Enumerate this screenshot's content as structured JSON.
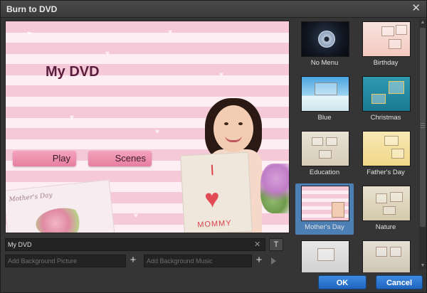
{
  "window": {
    "title": "Burn to DVD"
  },
  "preview": {
    "dvd_title": "My DVD",
    "play_label": "Play",
    "scenes_label": "Scenes",
    "card_text": "Mother's Day",
    "sign_top": "I",
    "sign_bottom": "MOMMY"
  },
  "inputs": {
    "title_value": "My DVD",
    "bg_picture_placeholder": "Add Background Picture",
    "bg_music_placeholder": "Add Background Music",
    "font_button": "T"
  },
  "templates": [
    {
      "label": "No Menu"
    },
    {
      "label": "Birthday"
    },
    {
      "label": "Blue"
    },
    {
      "label": "Christmas"
    },
    {
      "label": "Education"
    },
    {
      "label": "Father's Day"
    },
    {
      "label": "Mother's Day"
    },
    {
      "label": "Nature"
    }
  ],
  "selected_template": "Mother's Day",
  "footer": {
    "ok_label": "OK",
    "cancel_label": "Cancel"
  },
  "icons": {
    "close": "close-icon",
    "clear": "clear-icon",
    "add": "plus-icon",
    "play": "play-icon",
    "font": "text-format-icon"
  },
  "colors": {
    "accent": "#2f7ad6",
    "selection": "#4c7fb3"
  }
}
